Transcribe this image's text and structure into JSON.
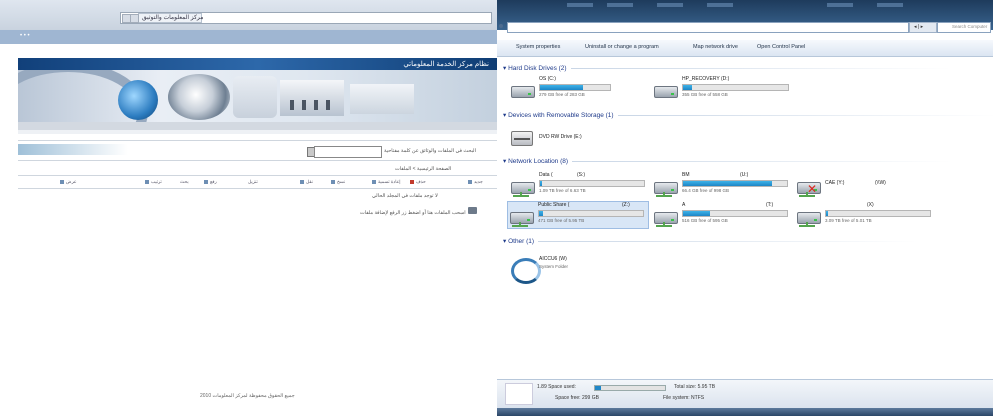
{
  "left": {
    "browser_tab": "مركز المعلومات والتوثيق",
    "portal_title": "نظام مركز الخدمة المعلوماتي",
    "search_label": "البحث في الملفات والوثائق عن كلمة مفتاحية",
    "breadcrumb": "الصفحة الرئيسية > الملفات",
    "toolbar": [
      "جديد",
      "حذف",
      "إعادة تسمية",
      "نسخ",
      "نقل",
      "تنزيل",
      "رفع",
      "بحث",
      "ترتيب",
      "عرض"
    ],
    "folder_note": "لا توجد ملفات في المجلد الحالي",
    "upload_note": "اسحب الملفات هنا أو اضغط زر الرفع لإضافة ملفات",
    "footer": "جميع الحقوق محفوظة لمركز المعلومات 2010"
  },
  "right": {
    "search_placeholder": "Search Computer",
    "nav_label": "◂ | ▸",
    "commands": [
      "System properties",
      "Uninstall or change a program",
      "Map network drive",
      "Open Control Panel"
    ],
    "groups": {
      "hdd": "Hard Disk Drives (2)",
      "removable": "Devices with Removable Storage (1)",
      "network": "Network Location (8)",
      "other": "Other (1)"
    },
    "hdd": [
      {
        "name": "OS (C:)",
        "free": "279 GB free of 283 GB",
        "fill": 0.61
      },
      {
        "name": "HP_RECOVERY (D:)",
        "free": "355 GB free of 558 GB",
        "fill": 0.09
      }
    ],
    "removable": [
      {
        "name": "DVD RW Drive (E:)"
      }
    ],
    "network": [
      {
        "name": "Data (",
        "suffix": "(S:)",
        "free": "1.09 TB free of 6.63 TB",
        "fill": 0.02
      },
      {
        "name": "BM",
        "suffix": "(U:)",
        "free": "66.4 GB free of 998 GB",
        "fill": 0.86
      },
      {
        "name": "CAE (Y:)",
        "suffix": "(\\\\W)",
        "free": "",
        "fill": 0,
        "error": true
      },
      {
        "name": "Public Share (",
        "suffix": "(Z:)",
        "free": "471 GB free of 5.95 TB",
        "fill": 0.04,
        "selected": true
      },
      {
        "name": "A",
        "suffix": "(T:)",
        "free": "516 GB free of 595 GB",
        "fill": 0.26
      },
      {
        "name": "(X)",
        "suffix": "",
        "free": "3.09 TB free of 5.01 TB",
        "fill": 0.02
      }
    ],
    "other": [
      {
        "name": "AICCU6 (W)",
        "type": "System Folder"
      }
    ],
    "status": {
      "space_used_label": "1.89 Space used:",
      "total_size": "Total size: 5.95 TB",
      "space_free": "Space free: 299 GB",
      "file_system": "File system: NTFS",
      "used_fill": 0.08
    },
    "colors": {
      "bar_fill": "#1d86c6",
      "group_heading": "#1e3a8a"
    }
  }
}
